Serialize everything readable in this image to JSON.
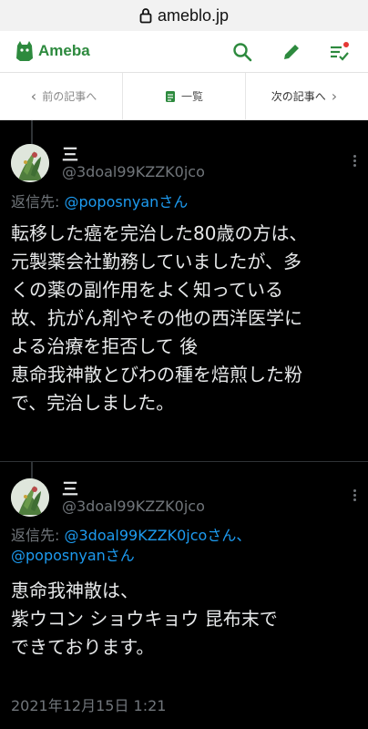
{
  "browser": {
    "url": "ameblo.jp"
  },
  "ameba": {
    "logo_text": "Ameba"
  },
  "article_nav": {
    "prev_label": "前の記事へ",
    "list_label": "一覧",
    "next_label": "次の記事へ"
  },
  "tweets": [
    {
      "display_name": "三",
      "handle": "@3doal99KZZK0jco",
      "reply_prefix": "返信先: ",
      "reply_mentions": "@poposnyanさん",
      "reply_mentions_2": "",
      "body": "転移した癌を完治した80歳の方は、\n元製薬会社勤務していましたが、多\nくの薬の副作用をよく知っている\n故、抗がん剤やその他の西洋医学に\nよる治療を拒否して 後\n恵命我神散とびわの種を焙煎した粉\nで、完治しました。"
    },
    {
      "display_name": "三",
      "handle": "@3doal99KZZK0jco",
      "reply_prefix": "返信先: ",
      "reply_mentions": "@3doal99KZZK0jcoさん、",
      "reply_mentions_2": "@poposnyanさん",
      "body": "恵命我神散は、\n紫ウコン ショウキョウ 昆布末で\nできております。",
      "timestamp": "2021年12月15日 1:21"
    }
  ],
  "colors": {
    "ameba_green": "#2d8a3e",
    "twitter_blue": "#1d9bf0",
    "notification_red": "#e53935"
  }
}
